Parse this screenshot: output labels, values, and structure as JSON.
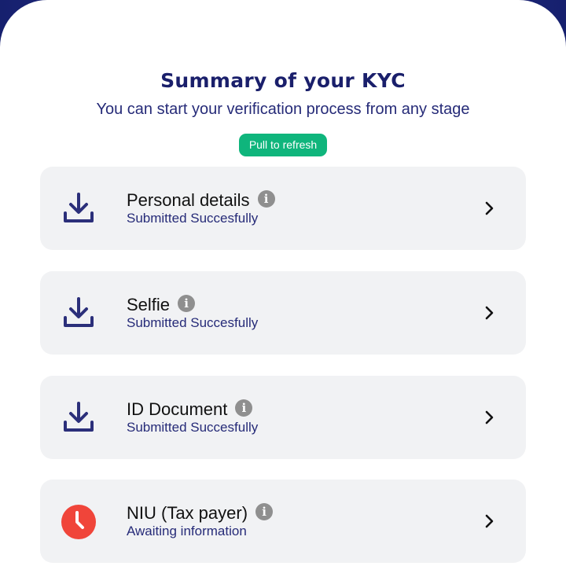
{
  "header": {
    "title": "Summary of your KYC",
    "subtitle": "You can start your verification process from any stage",
    "refresh_label": "Pull to refresh"
  },
  "colors": {
    "accent_green": "#0fb57c",
    "brand_navy": "#1a1f6b",
    "warning_red": "#f0453a",
    "card_bg": "#f1f2f4"
  },
  "kyc_items": [
    {
      "label": "Personal details",
      "status": "Submitted Succesfully",
      "icon": "download-icon"
    },
    {
      "label": "Selfie",
      "status": "Submitted Succesfully",
      "icon": "download-icon"
    },
    {
      "label": "ID Document",
      "status": "Submitted Succesfully",
      "icon": "download-icon"
    },
    {
      "label": "NIU (Tax payer)",
      "status": "Awaiting information",
      "icon": "clock-icon"
    }
  ]
}
